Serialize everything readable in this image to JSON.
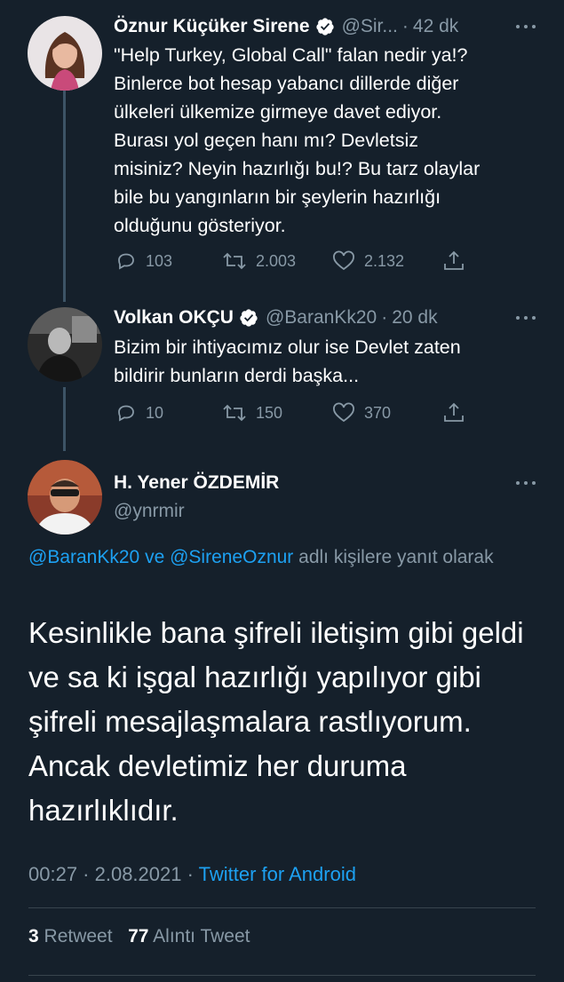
{
  "tweets": [
    {
      "name": "Öznur Küçüker Sirene",
      "handle": "@Sir...",
      "time": "42 dk",
      "text": "\"Help Turkey, Global Call\" falan nedir ya!?\nBinlerce bot hesap yabancı dillerde diğer\nülkeleri ülkemize girmeye davet ediyor.\nBurası yol geçen hanı mı? Devletsiz\nmisiniz? Neyin hazırlığı bu!? Bu tarz olaylar\nbile bu yangınların bir şeylerin hazırlığı\nolduğunu gösteriyor.",
      "replies": "103",
      "retweets": "2.003",
      "likes": "2.132"
    },
    {
      "name": "Volkan OKÇU",
      "handle": "@BaranKk20",
      "time": "20 dk",
      "text": "Bizim bir ihtiyacımız olur ise Devlet zaten\nbildirir bunların derdi başka...",
      "replies": "10",
      "retweets": "150",
      "likes": "370"
    }
  ],
  "main": {
    "name": "H. Yener ÖZDEMİR",
    "handle": "@ynrmir",
    "reply_to_user1": "@BaranKk20",
    "reply_to_and": " ve ",
    "reply_to_user2": "@SireneOznur",
    "reply_to_suffix": " adlı kişilere yanıt olarak",
    "text": "Kesinlikle bana şifreli iletişim gibi geldi ve sa ki işgal hazırlığı yapılıyor gibi şifreli  mesajlaşmalara rastlıyorum. Ancak devletimiz her duruma hazırlıklıdır.",
    "timestamp": "00:27 · 2.08.2021 · ",
    "source": "Twitter for Android",
    "retweet_count": "3",
    "retweet_label": "Retweet",
    "quote_count": "77",
    "quote_label": "Alıntı Tweet"
  },
  "colors": {
    "background": "#15202b",
    "secondary_text": "#8899a6",
    "link": "#1da1f2",
    "verified": "#ffffff"
  }
}
